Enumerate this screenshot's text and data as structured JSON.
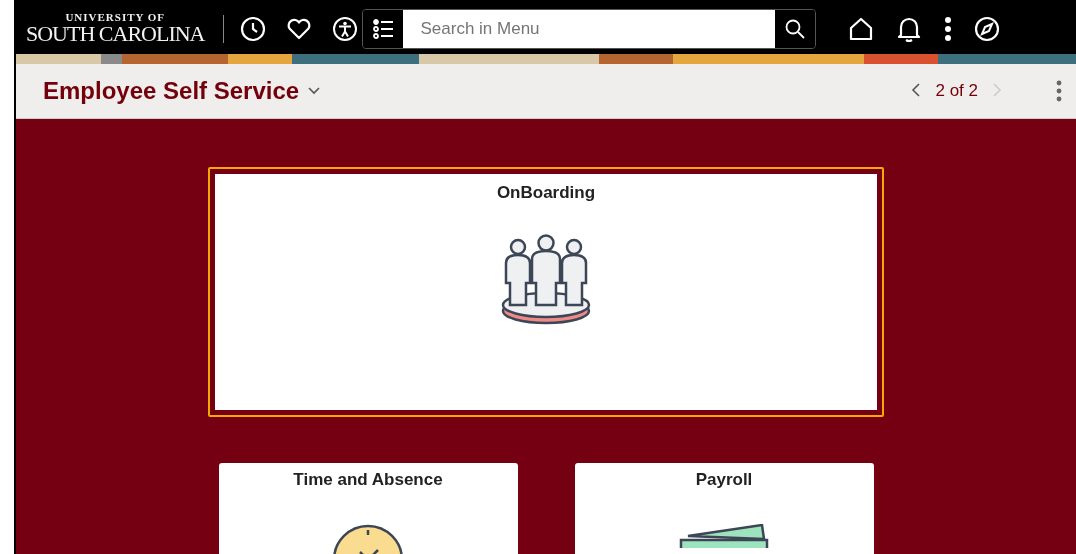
{
  "header": {
    "logo_top": "UNIVERSITY OF",
    "logo_bottom": "SOUTH CAROLINA",
    "search": {
      "placeholder": "Search in Menu"
    }
  },
  "title_bar": {
    "title": "Employee Self Service",
    "pager": {
      "text": "2 of 2",
      "prev_disabled": false,
      "next_disabled": true
    }
  },
  "tiles": [
    {
      "title": "OnBoarding",
      "kind": "people",
      "focused": true
    },
    {
      "title": "Time and Absence",
      "kind": "clock",
      "focused": false
    },
    {
      "title": "Payroll",
      "kind": "money",
      "focused": false
    }
  ]
}
